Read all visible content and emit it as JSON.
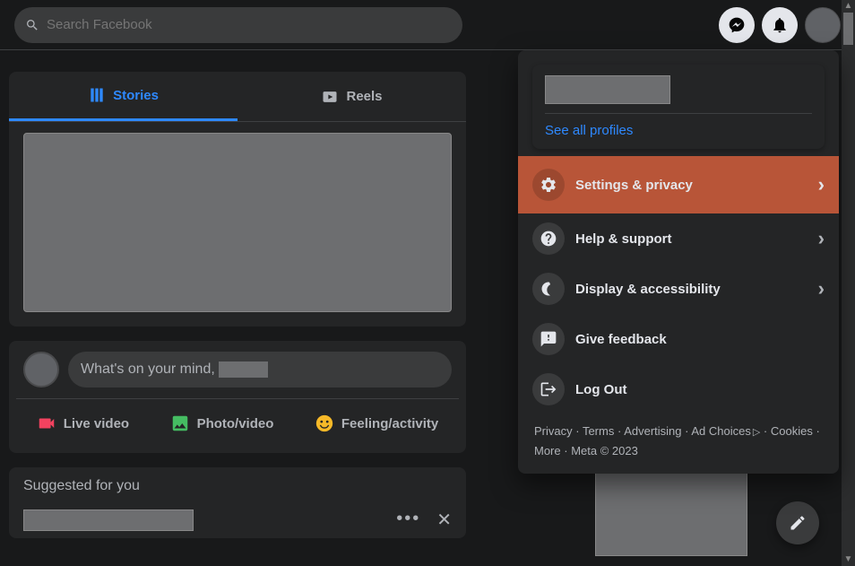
{
  "search": {
    "placeholder": "Search Facebook"
  },
  "tabs": {
    "stories": "Stories",
    "reels": "Reels"
  },
  "composer": {
    "prompt": "What's on your mind,",
    "live": "Live video",
    "photo": "Photo/video",
    "feeling": "Feeling/activity"
  },
  "suggested": {
    "heading": "Suggested for you"
  },
  "menu": {
    "see_all": "See all profiles",
    "settings": "Settings & privacy",
    "help": "Help & support",
    "display": "Display & accessibility",
    "feedback": "Give feedback",
    "logout": "Log Out"
  },
  "footer": {
    "privacy": "Privacy",
    "terms": "Terms",
    "advertising": "Advertising",
    "adchoices": "Ad Choices",
    "cookies": "Cookies",
    "more": "More",
    "meta": "Meta © 2023"
  }
}
